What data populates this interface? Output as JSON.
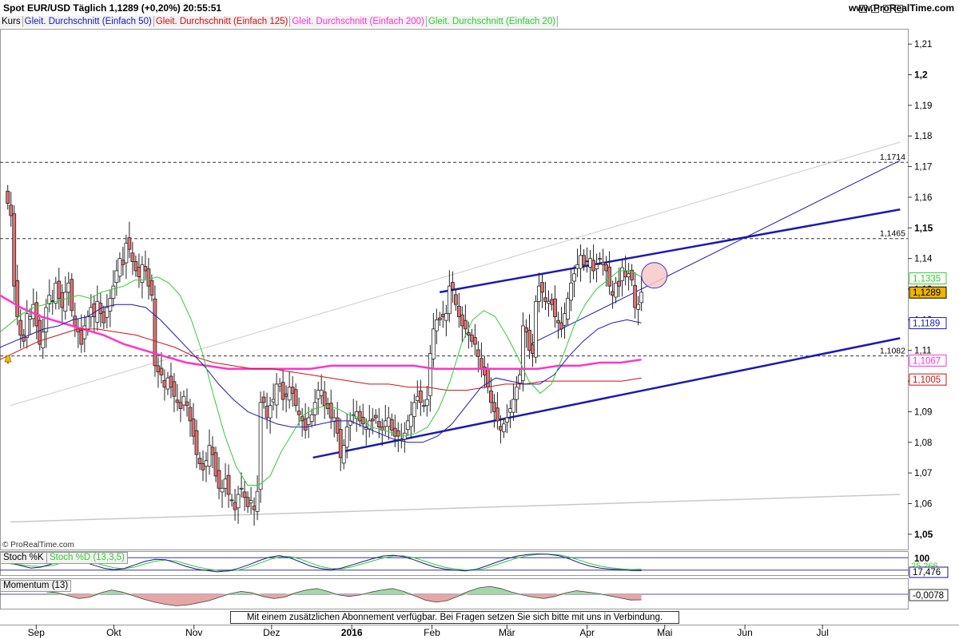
{
  "header": {
    "title": "Spot EUR/USD   Täglich   1,1289 (+0,20%)   20:55:51",
    "brand": "www.ProRealTime.com",
    "swatch_colors": [
      "#e6e6e6",
      "#ffffff",
      "#ffffff",
      "#ffffff"
    ]
  },
  "legend": {
    "kurs": "Kurs",
    "items": [
      {
        "label": "Gleit. Durchschnitt (Einfach 50)",
        "color": "#1a1ab0"
      },
      {
        "label": "Gleit. Durchschnitt (Einfach 125)",
        "color": "#cc1111"
      },
      {
        "label": "Gleit. Durchschnitt (Einfach 200)",
        "color": "#ff33cc"
      },
      {
        "label": "Gleit. Durchschnitt (Einfach 20)",
        "color": "#33cc33"
      }
    ]
  },
  "copyright": "© ProRealTime.com",
  "footnote": "Mit einem zusätzlichen Abonnement verfügbar. Bei Fragen setzen Sie sich bitte mit uns in Verbindung.",
  "chart_data": [
    {
      "type": "candlestick",
      "ylim": [
        1.045,
        1.215
      ],
      "y_ticks": [
        "1,21",
        "1,2",
        "1,19",
        "1,18",
        "1,17",
        "1,16",
        "1,15",
        "1,14",
        "1,13",
        "1,12",
        "1,11",
        "1,1",
        "1,09",
        "1,08",
        "1,07",
        "1,06",
        "1,05"
      ],
      "y_tick_values": [
        1.21,
        1.2,
        1.19,
        1.18,
        1.17,
        1.16,
        1.15,
        1.14,
        1.13,
        1.12,
        1.11,
        1.1,
        1.09,
        1.08,
        1.07,
        1.06,
        1.05
      ],
      "x_ticks": [
        "Sep",
        "Okt",
        "Nov",
        "Dez",
        "2016",
        "Feb",
        "Mär",
        "Apr",
        "Mai",
        "Jun",
        "Jul"
      ],
      "x_tick_dates": [
        "2015-09-01",
        "2015-10-01",
        "2015-11-01",
        "2015-12-01",
        "2016-01-01",
        "2016-02-01",
        "2016-03-01",
        "2016-04-01",
        "2016-05-01",
        "2016-06-01",
        "2016-07-01"
      ],
      "last_date": "2016-04-22",
      "horizontal_levels": [
        {
          "value": 1.1714,
          "label": "1,1714"
        },
        {
          "value": 1.1465,
          "label": "1,1465"
        },
        {
          "value": 1.1082,
          "label": "1,1082"
        }
      ],
      "price_tags": [
        {
          "label": "1,1335",
          "value": 1.1335,
          "color": "#33cc33",
          "fill": "#ffffff"
        },
        {
          "label": "1,1289",
          "value": 1.1289,
          "color": "#000000",
          "fill": "#f0b400"
        },
        {
          "label": "1,1189",
          "value": 1.1189,
          "color": "#1a1ab0",
          "fill": "#ffffff"
        },
        {
          "label": "1,1067",
          "value": 1.1067,
          "color": "#ff33cc",
          "fill": "#ffffff"
        },
        {
          "label": "1,1005",
          "value": 1.1005,
          "color": "#cc1111",
          "fill": "#ffffff"
        }
      ],
      "candles_close": [
        1.158,
        1.154,
        1.131,
        1.121,
        1.115,
        1.113,
        1.122,
        1.121,
        1.125,
        1.118,
        1.112,
        1.116,
        1.124,
        1.128,
        1.126,
        1.132,
        1.127,
        1.124,
        1.129,
        1.132,
        1.123,
        1.118,
        1.116,
        1.112,
        1.118,
        1.121,
        1.124,
        1.121,
        1.126,
        1.122,
        1.119,
        1.124,
        1.127,
        1.131,
        1.136,
        1.14,
        1.138,
        1.145,
        1.143,
        1.139,
        1.136,
        1.134,
        1.138,
        1.136,
        1.131,
        1.128,
        1.105,
        1.103,
        1.102,
        1.098,
        1.101,
        1.098,
        1.095,
        1.093,
        1.091,
        1.095,
        1.092,
        1.087,
        1.082,
        1.076,
        1.073,
        1.071,
        1.074,
        1.079,
        1.076,
        1.069,
        1.065,
        1.065,
        1.068,
        1.063,
        1.061,
        1.058,
        1.063,
        1.065,
        1.062,
        1.059,
        1.061,
        1.058,
        1.064,
        1.093,
        1.093,
        1.088,
        1.092,
        1.094,
        1.099,
        1.099,
        1.094,
        1.095,
        1.098,
        1.096,
        1.092,
        1.089,
        1.087,
        1.084,
        1.088,
        1.089,
        1.093,
        1.097,
        1.097,
        1.092,
        1.091,
        1.088,
        1.088,
        1.083,
        1.075,
        1.079,
        1.085,
        1.087,
        1.089,
        1.09,
        1.087,
        1.086,
        1.085,
        1.087,
        1.087,
        1.088,
        1.085,
        1.084,
        1.087,
        1.088,
        1.084,
        1.082,
        1.082,
        1.081,
        1.083,
        1.087,
        1.089,
        1.093,
        1.095,
        1.093,
        1.092,
        1.094,
        1.109,
        1.117,
        1.12,
        1.12,
        1.121,
        1.122,
        1.131,
        1.13,
        1.125,
        1.121,
        1.118,
        1.117,
        1.115,
        1.113,
        1.112,
        1.108,
        1.104,
        1.102,
        1.098,
        1.093,
        1.09,
        1.087,
        1.084,
        1.086,
        1.088,
        1.091,
        1.094,
        1.098,
        1.102,
        1.118,
        1.116,
        1.11,
        1.109,
        1.126,
        1.131,
        1.129,
        1.126,
        1.126,
        1.125,
        1.121,
        1.119,
        1.117,
        1.122,
        1.127,
        1.132,
        1.135,
        1.138,
        1.141,
        1.138,
        1.139,
        1.14,
        1.136,
        1.138,
        1.14,
        1.138,
        1.136,
        1.131,
        1.128,
        1.132,
        1.131,
        1.137,
        1.134,
        1.135,
        1.133,
        1.124,
        1.125,
        1.129
      ],
      "sma_20": [
        [
          1.116,
          1.119,
          1.122,
          1.124,
          1.125,
          1.126,
          1.127,
          1.128,
          1.127,
          1.129,
          1.13,
          1.131,
          1.133,
          1.133,
          1.134,
          1.132,
          1.128,
          1.12,
          1.109,
          1.095,
          1.082,
          1.072,
          1.066,
          1.066,
          1.069,
          1.077,
          1.083,
          1.089,
          1.091,
          1.092,
          1.091,
          1.089,
          1.088,
          1.085,
          1.084,
          1.083,
          1.082,
          1.083,
          1.085,
          1.091,
          1.1,
          1.112,
          1.12,
          1.123,
          1.121,
          1.115,
          1.108,
          1.1,
          1.096,
          1.099,
          1.108,
          1.118,
          1.125,
          1.13,
          1.133,
          1.136,
          1.136,
          1.134
        ]
      ],
      "sma_50": [
        1.111,
        1.113,
        1.115,
        1.117,
        1.118,
        1.12,
        1.121,
        1.124,
        1.125,
        1.125,
        1.124,
        1.12,
        1.115,
        1.11,
        1.105,
        1.099,
        1.094,
        1.09,
        1.088,
        1.086,
        1.085,
        1.085,
        1.086,
        1.087,
        1.087,
        1.085,
        1.083,
        1.081,
        1.08,
        1.08,
        1.082,
        1.086,
        1.092,
        1.098,
        1.101,
        1.1,
        1.099,
        1.099,
        1.102,
        1.108,
        1.113,
        1.117,
        1.119,
        1.12,
        1.119
      ],
      "sma_125": [
        1.107,
        1.11,
        1.113,
        1.115,
        1.117,
        1.117,
        1.116,
        1.115,
        1.113,
        1.111,
        1.108,
        1.106,
        1.105,
        1.104,
        1.104,
        1.103,
        1.102,
        1.101,
        1.1,
        1.099,
        1.099,
        1.098,
        1.098,
        1.097,
        1.097,
        1.098,
        1.099,
        1.099,
        1.1,
        1.1,
        1.1,
        1.1,
        1.1,
        1.101
      ],
      "sma_200": [
        1.128,
        1.124,
        1.121,
        1.119,
        1.117,
        1.115,
        1.112,
        1.11,
        1.108,
        1.106,
        1.105,
        1.104,
        1.104,
        1.104,
        1.104,
        1.104,
        1.105,
        1.105,
        1.105,
        1.105,
        1.105,
        1.104,
        1.104,
        1.104,
        1.104,
        1.104,
        1.104,
        1.105,
        1.105,
        1.106,
        1.106,
        1.107
      ],
      "trend_lines": [
        {
          "from": [
            "2015-12-17",
            1.075
          ],
          "to": [
            "2016-07-31",
            1.114
          ],
          "color": "#1a1ab0",
          "width": 2.5
        },
        {
          "from": [
            "2016-02-04",
            1.129
          ],
          "to": [
            "2016-07-31",
            1.156
          ],
          "color": "#1a1ab0",
          "width": 2.5
        },
        {
          "from": [
            "2016-03-10",
            1.112
          ],
          "to": [
            "2016-07-31",
            1.172
          ],
          "color": "#1a1ab0",
          "width": 1
        },
        {
          "from": [
            "2015-08-22",
            1.092
          ],
          "to": [
            "2016-07-31",
            1.178
          ],
          "color": "#cccccc",
          "width": 1
        },
        {
          "from": [
            "2015-08-22",
            1.054
          ],
          "to": [
            "2016-07-31",
            1.063
          ],
          "color": "#c8c8c8",
          "width": 1.5
        }
      ],
      "marker": {
        "date": "2016-04-27",
        "value": 1.1345,
        "fill": "#f8c8c8",
        "stroke": "#3333cc"
      }
    },
    {
      "type": "line",
      "title": "Stoch %K",
      "series": [
        {
          "name": "Stoch %K",
          "color": "#1a1a80"
        },
        {
          "name": "Stoch %D (13,3,5)",
          "color": "#33cc33"
        }
      ],
      "y_ticks": [
        "100"
      ],
      "tags": [
        "25,266",
        "17,476"
      ],
      "k": [
        55,
        42,
        30,
        35,
        50,
        70,
        80,
        62,
        45,
        30,
        22,
        28,
        45,
        62,
        72,
        70,
        55,
        38,
        25,
        18,
        12,
        16,
        28,
        45,
        65,
        82,
        90,
        80,
        60,
        40,
        28,
        22,
        30,
        45,
        60,
        75,
        88,
        92,
        85,
        70,
        52,
        35,
        25,
        20,
        16,
        24,
        40,
        58,
        75,
        88,
        95,
        98,
        96,
        90,
        75,
        55,
        40,
        30,
        25,
        22,
        18,
        17.5
      ],
      "d": [
        50,
        46,
        40,
        37,
        42,
        55,
        68,
        70,
        58,
        44,
        32,
        27,
        35,
        50,
        63,
        69,
        64,
        50,
        36,
        26,
        18,
        15,
        20,
        34,
        52,
        70,
        84,
        86,
        74,
        55,
        38,
        28,
        26,
        36,
        50,
        64,
        78,
        88,
        89,
        80,
        64,
        48,
        34,
        26,
        20,
        20,
        30,
        46,
        63,
        78,
        90,
        96,
        97,
        94,
        84,
        68,
        52,
        40,
        32,
        27,
        23,
        25.3
      ]
    },
    {
      "type": "area",
      "title": "Momentum (13)",
      "tag": "-0,0078",
      "values": [
        0.004,
        0.002,
        -0.002,
        -0.006,
        -0.004,
        0.002,
        0.006,
        0.003,
        -0.002,
        -0.007,
        -0.011,
        -0.014,
        -0.016,
        -0.015,
        -0.012,
        -0.009,
        -0.004,
        0.001,
        0.004,
        0.002,
        -0.003,
        -0.006,
        -0.004,
        0.002,
        0.006,
        0.008,
        0.004,
        -0.001,
        -0.003,
        -0.001,
        0.003,
        0.006,
        0.008,
        0.004,
        -0.002,
        -0.008,
        -0.011,
        -0.009,
        -0.003,
        0.004,
        0.009,
        0.011,
        0.008,
        0.003,
        -0.001,
        -0.004,
        -0.006,
        -0.003,
        0.002,
        0.005,
        0.003,
        0.001,
        -0.002,
        -0.005,
        -0.008,
        -0.0078
      ]
    }
  ]
}
